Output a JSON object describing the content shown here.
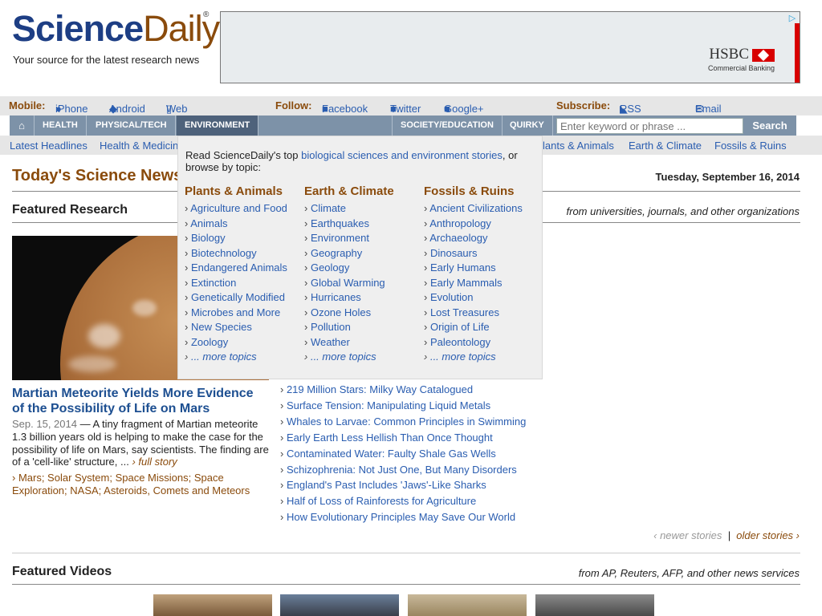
{
  "brand": {
    "name_a": "Science",
    "name_b": "Daily",
    "reg": "®",
    "tagline": "Your source for the latest research news"
  },
  "ad": {
    "brand": "HSBC",
    "sub": "Commercial Banking",
    "choices": "▷"
  },
  "topbar": {
    "mobile_label": "Mobile:",
    "iphone": "iPhone",
    "android": "Android",
    "web": "Web",
    "follow_label": "Follow:",
    "facebook": "Facebook",
    "twitter": "Twitter",
    "google": "Google+",
    "subscribe_label": "Subscribe:",
    "rss": "RSS Feeds",
    "email": "Email Newsletters"
  },
  "nav": {
    "home": "⌂",
    "health": "Health",
    "physical": "Physical/Tech",
    "environment": "Environment",
    "society": "Society/Education",
    "quirky": "Quirky",
    "search_placeholder": "Enter keyword or phrase ...",
    "search_button": "Search"
  },
  "subnav": {
    "latest": "Latest Headlines",
    "health": "Health & Medicin",
    "plants": "lants & Animals",
    "earth": "Earth & Climate",
    "fossils": "Fossils & Ruins"
  },
  "page": {
    "title": "Today's Science News",
    "date": "Tuesday, September 16, 2014",
    "featured": "Featured Research",
    "featured_sub": "from universities, journals, and other organizations",
    "videos": "Featured Videos",
    "videos_sub": "from AP, Reuters, AFP, and other news services",
    "newer": "‹ newer stories",
    "sep": "|",
    "older": "older stories ›"
  },
  "lead": {
    "headline": "Martian Meteorite Yields More Evidence of the Possibility of Life on Mars",
    "date": "Sep. 15, 2014",
    "summary": "— A tiny fragment of Martian meteorite 1.3 billion years old is helping to make the case for the possibility of life on Mars, say scientists. The finding are of a 'cell-like' structure, ...",
    "full": "› full story",
    "tags": "› Mars; Solar System; Space Missions; Space Exploration; NASA; Asteroids, Comets and Meteors"
  },
  "stories": [
    "219 Million Stars: Milky Way Catalogued",
    "Surface Tension: Manipulating Liquid Metals",
    "Whales to Larvae: Common Principles in Swimming",
    "Early Earth Less Hellish Than Once Thought",
    "Contaminated Water: Faulty Shale Gas Wells",
    "Schizophrenia: Not Just One, But Many Disorders",
    "England's Past Includes 'Jaws'-Like Sharks",
    "Half of Loss of Rainforests for Agriculture",
    "How Evolutionary Principles May Save Our World"
  ],
  "dropdown": {
    "intro_a": "Read ScienceDaily's top ",
    "intro_link": "biological sciences and environment stories",
    "intro_b": ", or browse by topic:",
    "cols": [
      {
        "title": "Plants & Animals",
        "items": [
          "Agriculture and Food",
          "Animals",
          "Biology",
          "Biotechnology",
          "Endangered Animals",
          "Extinction",
          "Genetically Modified",
          "Microbes and More",
          "New Species",
          "Zoology",
          "... more topics"
        ]
      },
      {
        "title": "Earth & Climate",
        "items": [
          "Climate",
          "Earthquakes",
          "Environment",
          "Geography",
          "Geology",
          "Global Warming",
          "Hurricanes",
          "Ozone Holes",
          "Pollution",
          "Weather",
          "... more topics"
        ]
      },
      {
        "title": "Fossils & Ruins",
        "items": [
          "Ancient Civilizations",
          "Anthropology",
          "Archaeology",
          "Dinosaurs",
          "Early Humans",
          "Early Mammals",
          "Evolution",
          "Lost Treasures",
          "Origin of Life",
          "Paleontology",
          "... more topics"
        ]
      }
    ]
  }
}
